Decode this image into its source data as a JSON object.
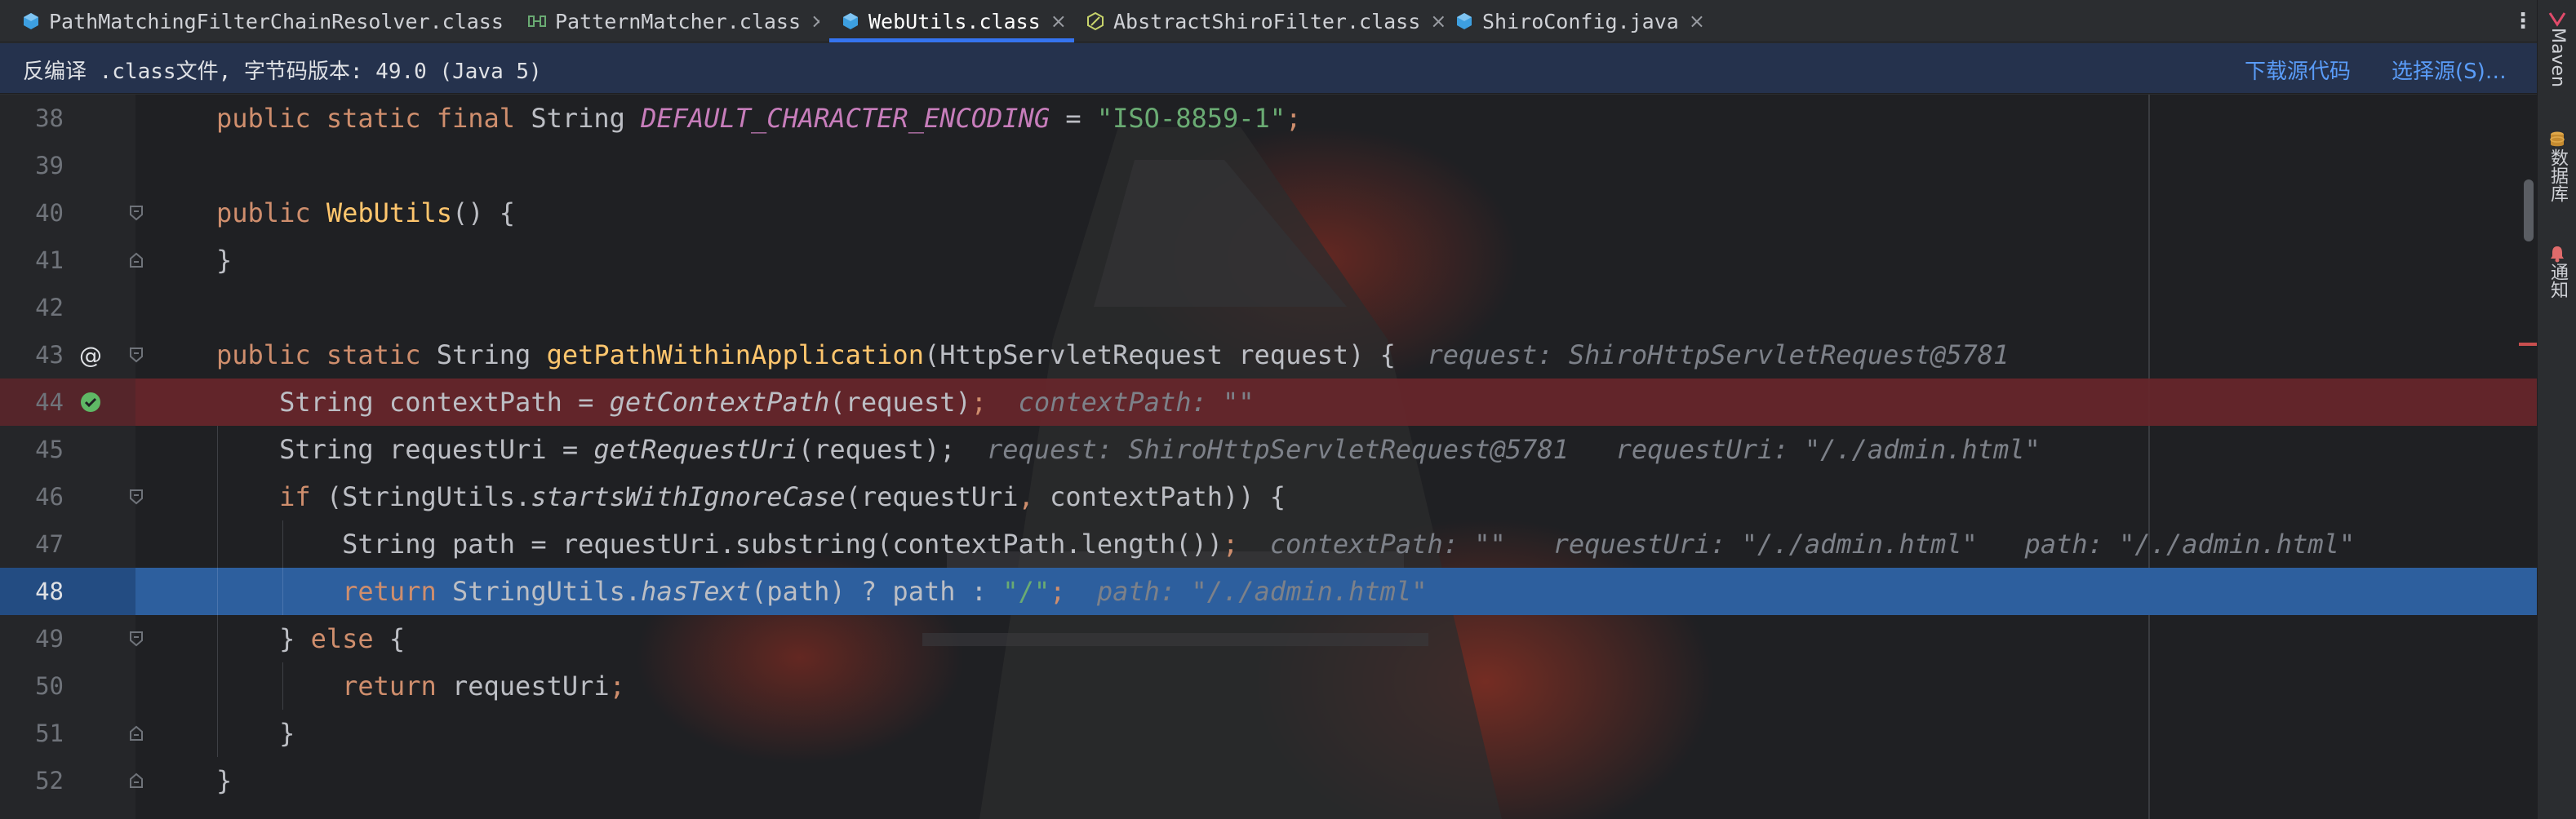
{
  "tabs": [
    {
      "label": "PathMatchingFilterChainResolver.class",
      "icon": "class-icon",
      "active": false
    },
    {
      "label": "PatternMatcher.class",
      "icon": "interface-icon",
      "active": false
    },
    {
      "label": "WebUtils.class",
      "icon": "class-icon",
      "active": true
    },
    {
      "label": "AbstractShiroFilter.class",
      "icon": "abstract-class-icon",
      "active": false
    },
    {
      "label": "ShiroConfig.java",
      "icon": "class-icon",
      "active": false
    }
  ],
  "tab_close_glyph": "×",
  "tab_more_glyph": "⋮",
  "notice": {
    "text": "反编译 .class文件, 字节码版本: 49.0 (Java 5)",
    "download_source": "下载源代码",
    "choose_source": "选择源(S)…"
  },
  "gutter": {
    "override_glyph": "@"
  },
  "lines": [
    {
      "number": "38",
      "tokens": [
        {
          "t": "public static final ",
          "c": "kw"
        },
        {
          "t": "String ",
          "c": "ty"
        },
        {
          "t": "DEFAULT_CHARACTER_ENCODING",
          "c": "cn"
        },
        {
          "t": " = ",
          "c": "id"
        },
        {
          "t": "\"ISO-8859-1\"",
          "c": "st"
        },
        {
          "t": ";",
          "c": "kw"
        }
      ]
    },
    {
      "number": "39",
      "tokens": []
    },
    {
      "number": "40",
      "tokens": [
        {
          "t": "public ",
          "c": "kw"
        },
        {
          "t": "WebUtils",
          "c": "fnd"
        },
        {
          "t": "() {",
          "c": "id"
        }
      ]
    },
    {
      "number": "41",
      "tokens": [
        {
          "t": "}",
          "c": "id"
        }
      ]
    },
    {
      "number": "42",
      "tokens": []
    },
    {
      "number": "43",
      "tokens": [
        {
          "t": "public static ",
          "c": "kw"
        },
        {
          "t": "String ",
          "c": "ty"
        },
        {
          "t": "getPathWithinApplication",
          "c": "fnd"
        },
        {
          "t": "(HttpServletRequest request) {",
          "c": "id"
        },
        {
          "t": "  request: ShiroHttpServletRequest@5781",
          "c": "hint"
        }
      ]
    },
    {
      "number": "44",
      "tokens": [
        {
          "t": "    String contextPath = ",
          "c": "id"
        },
        {
          "t": "getContextPath",
          "c": "it id"
        },
        {
          "t": "(request)",
          "c": "id"
        },
        {
          "t": ";",
          "c": "kw"
        },
        {
          "t": "  contextPath: \"\"",
          "c": "hint"
        }
      ]
    },
    {
      "number": "45",
      "tokens": [
        {
          "t": "    String requestUri = ",
          "c": "id"
        },
        {
          "t": "getRequestUri",
          "c": "it id"
        },
        {
          "t": "(request);",
          "c": "id"
        },
        {
          "t": "  request: ShiroHttpServletRequest@5781   requestUri: \"/./admin.html\"",
          "c": "hint"
        }
      ]
    },
    {
      "number": "46",
      "tokens": [
        {
          "t": "    ",
          "c": "id"
        },
        {
          "t": "if ",
          "c": "kw"
        },
        {
          "t": "(StringUtils.",
          "c": "id"
        },
        {
          "t": "startsWithIgnoreCase",
          "c": "it id"
        },
        {
          "t": "(requestUri",
          "c": "id"
        },
        {
          "t": ", ",
          "c": "kw"
        },
        {
          "t": "contextPath)) {",
          "c": "id"
        }
      ]
    },
    {
      "number": "47",
      "tokens": [
        {
          "t": "        String path = requestUri.substring(contextPath.length())",
          "c": "id"
        },
        {
          "t": ";",
          "c": "kw"
        },
        {
          "t": "  contextPath: \"\"   requestUri: \"/./admin.html\"   path: \"/./admin.html\"",
          "c": "hint"
        }
      ]
    },
    {
      "number": "48",
      "tokens": [
        {
          "t": "        ",
          "c": "id"
        },
        {
          "t": "return ",
          "c": "kw"
        },
        {
          "t": "StringUtils.",
          "c": "id"
        },
        {
          "t": "hasText",
          "c": "it id"
        },
        {
          "t": "(path) ? path : ",
          "c": "id"
        },
        {
          "t": "\"/\"",
          "c": "st"
        },
        {
          "t": ";",
          "c": "kw"
        },
        {
          "t": "  path: \"/./admin.html\"",
          "c": "hint"
        }
      ]
    },
    {
      "number": "49",
      "tokens": [
        {
          "t": "    } ",
          "c": "id"
        },
        {
          "t": "else ",
          "c": "kw"
        },
        {
          "t": "{",
          "c": "id"
        }
      ]
    },
    {
      "number": "50",
      "tokens": [
        {
          "t": "        ",
          "c": "id"
        },
        {
          "t": "return ",
          "c": "kw"
        },
        {
          "t": "requestUri",
          "c": "id"
        },
        {
          "t": ";",
          "c": "kw"
        }
      ]
    },
    {
      "number": "51",
      "tokens": [
        {
          "t": "    }",
          "c": "id"
        }
      ]
    },
    {
      "number": "52",
      "tokens": [
        {
          "t": "}",
          "c": "id"
        }
      ]
    }
  ],
  "right_strip": {
    "maven": "Maven",
    "database": "数据库",
    "notifications": "通知"
  },
  "colors": {
    "accent": "#3574f0",
    "breakpoint_line": "#5c252a",
    "execution_line": "#2d5f9e",
    "keyword": "#cf8e6d",
    "string": "#6aab73",
    "constant": "#c77dbb",
    "method_decl": "#ffc66d"
  }
}
